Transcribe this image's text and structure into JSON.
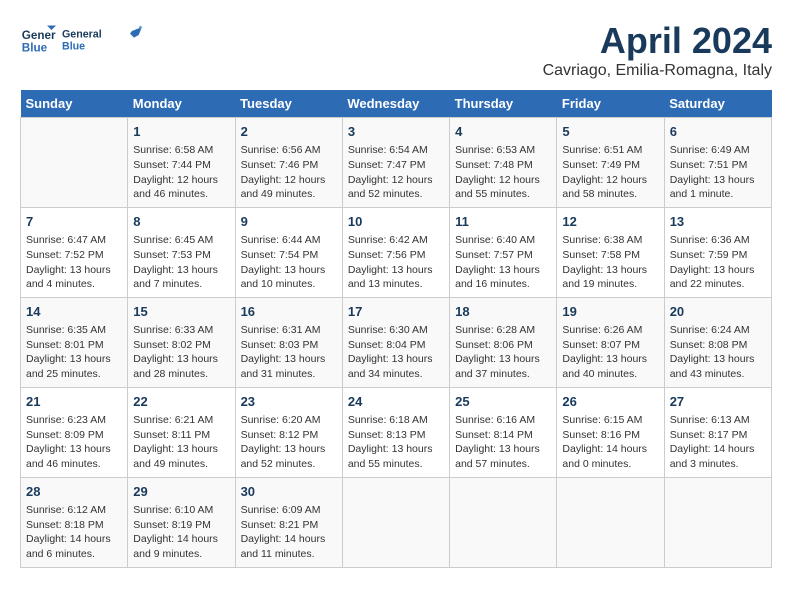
{
  "header": {
    "logo_line1": "General",
    "logo_line2": "Blue",
    "title": "April 2024",
    "subtitle": "Cavriago, Emilia-Romagna, Italy"
  },
  "calendar": {
    "days_of_week": [
      "Sunday",
      "Monday",
      "Tuesday",
      "Wednesday",
      "Thursday",
      "Friday",
      "Saturday"
    ],
    "weeks": [
      [
        {
          "day": "",
          "info": ""
        },
        {
          "day": "1",
          "info": "Sunrise: 6:58 AM\nSunset: 7:44 PM\nDaylight: 12 hours\nand 46 minutes."
        },
        {
          "day": "2",
          "info": "Sunrise: 6:56 AM\nSunset: 7:46 PM\nDaylight: 12 hours\nand 49 minutes."
        },
        {
          "day": "3",
          "info": "Sunrise: 6:54 AM\nSunset: 7:47 PM\nDaylight: 12 hours\nand 52 minutes."
        },
        {
          "day": "4",
          "info": "Sunrise: 6:53 AM\nSunset: 7:48 PM\nDaylight: 12 hours\nand 55 minutes."
        },
        {
          "day": "5",
          "info": "Sunrise: 6:51 AM\nSunset: 7:49 PM\nDaylight: 12 hours\nand 58 minutes."
        },
        {
          "day": "6",
          "info": "Sunrise: 6:49 AM\nSunset: 7:51 PM\nDaylight: 13 hours\nand 1 minute."
        }
      ],
      [
        {
          "day": "7",
          "info": "Sunrise: 6:47 AM\nSunset: 7:52 PM\nDaylight: 13 hours\nand 4 minutes."
        },
        {
          "day": "8",
          "info": "Sunrise: 6:45 AM\nSunset: 7:53 PM\nDaylight: 13 hours\nand 7 minutes."
        },
        {
          "day": "9",
          "info": "Sunrise: 6:44 AM\nSunset: 7:54 PM\nDaylight: 13 hours\nand 10 minutes."
        },
        {
          "day": "10",
          "info": "Sunrise: 6:42 AM\nSunset: 7:56 PM\nDaylight: 13 hours\nand 13 minutes."
        },
        {
          "day": "11",
          "info": "Sunrise: 6:40 AM\nSunset: 7:57 PM\nDaylight: 13 hours\nand 16 minutes."
        },
        {
          "day": "12",
          "info": "Sunrise: 6:38 AM\nSunset: 7:58 PM\nDaylight: 13 hours\nand 19 minutes."
        },
        {
          "day": "13",
          "info": "Sunrise: 6:36 AM\nSunset: 7:59 PM\nDaylight: 13 hours\nand 22 minutes."
        }
      ],
      [
        {
          "day": "14",
          "info": "Sunrise: 6:35 AM\nSunset: 8:01 PM\nDaylight: 13 hours\nand 25 minutes."
        },
        {
          "day": "15",
          "info": "Sunrise: 6:33 AM\nSunset: 8:02 PM\nDaylight: 13 hours\nand 28 minutes."
        },
        {
          "day": "16",
          "info": "Sunrise: 6:31 AM\nSunset: 8:03 PM\nDaylight: 13 hours\nand 31 minutes."
        },
        {
          "day": "17",
          "info": "Sunrise: 6:30 AM\nSunset: 8:04 PM\nDaylight: 13 hours\nand 34 minutes."
        },
        {
          "day": "18",
          "info": "Sunrise: 6:28 AM\nSunset: 8:06 PM\nDaylight: 13 hours\nand 37 minutes."
        },
        {
          "day": "19",
          "info": "Sunrise: 6:26 AM\nSunset: 8:07 PM\nDaylight: 13 hours\nand 40 minutes."
        },
        {
          "day": "20",
          "info": "Sunrise: 6:24 AM\nSunset: 8:08 PM\nDaylight: 13 hours\nand 43 minutes."
        }
      ],
      [
        {
          "day": "21",
          "info": "Sunrise: 6:23 AM\nSunset: 8:09 PM\nDaylight: 13 hours\nand 46 minutes."
        },
        {
          "day": "22",
          "info": "Sunrise: 6:21 AM\nSunset: 8:11 PM\nDaylight: 13 hours\nand 49 minutes."
        },
        {
          "day": "23",
          "info": "Sunrise: 6:20 AM\nSunset: 8:12 PM\nDaylight: 13 hours\nand 52 minutes."
        },
        {
          "day": "24",
          "info": "Sunrise: 6:18 AM\nSunset: 8:13 PM\nDaylight: 13 hours\nand 55 minutes."
        },
        {
          "day": "25",
          "info": "Sunrise: 6:16 AM\nSunset: 8:14 PM\nDaylight: 13 hours\nand 57 minutes."
        },
        {
          "day": "26",
          "info": "Sunrise: 6:15 AM\nSunset: 8:16 PM\nDaylight: 14 hours\nand 0 minutes."
        },
        {
          "day": "27",
          "info": "Sunrise: 6:13 AM\nSunset: 8:17 PM\nDaylight: 14 hours\nand 3 minutes."
        }
      ],
      [
        {
          "day": "28",
          "info": "Sunrise: 6:12 AM\nSunset: 8:18 PM\nDaylight: 14 hours\nand 6 minutes."
        },
        {
          "day": "29",
          "info": "Sunrise: 6:10 AM\nSunset: 8:19 PM\nDaylight: 14 hours\nand 9 minutes."
        },
        {
          "day": "30",
          "info": "Sunrise: 6:09 AM\nSunset: 8:21 PM\nDaylight: 14 hours\nand 11 minutes."
        },
        {
          "day": "",
          "info": ""
        },
        {
          "day": "",
          "info": ""
        },
        {
          "day": "",
          "info": ""
        },
        {
          "day": "",
          "info": ""
        }
      ]
    ]
  }
}
